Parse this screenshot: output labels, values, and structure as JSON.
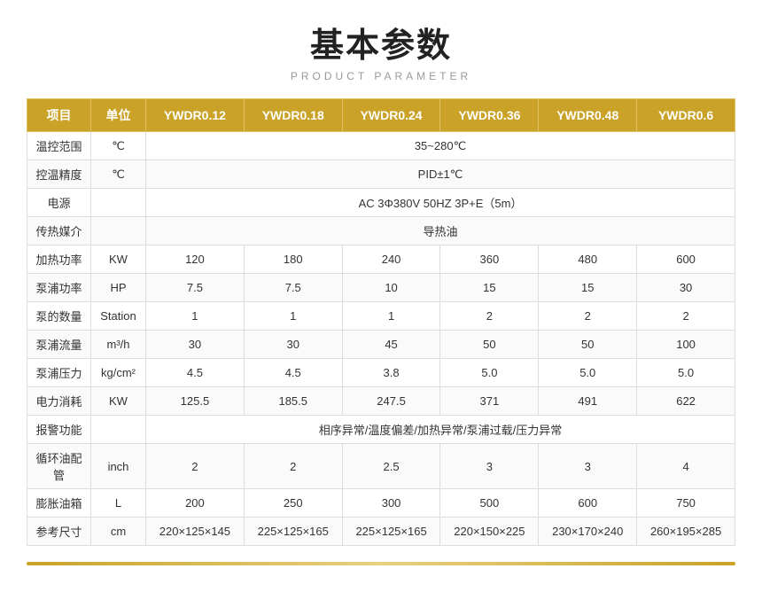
{
  "header": {
    "title": "基本参数",
    "subtitle": "PRODUCT PARAMETER"
  },
  "table": {
    "columns": [
      "项目",
      "单位",
      "YWDR0.12",
      "YWDR0.18",
      "YWDR0.24",
      "YWDR0.36",
      "YWDR0.48",
      "YWDR0.6"
    ],
    "rows": [
      {
        "label": "温控范围",
        "unit": "℃",
        "span": true,
        "spanText": "35~280℃"
      },
      {
        "label": "控温精度",
        "unit": "℃",
        "span": true,
        "spanText": "PID±1℃"
      },
      {
        "label": "电源",
        "unit": "",
        "span": true,
        "spanText": "AC 3Φ380V 50HZ 3P+E（5m）"
      },
      {
        "label": "传热媒介",
        "unit": "",
        "span": true,
        "spanText": "导热油"
      },
      {
        "label": "加热功率",
        "unit": "KW",
        "span": false,
        "values": [
          "120",
          "180",
          "240",
          "360",
          "480",
          "600"
        ]
      },
      {
        "label": "泵浦功率",
        "unit": "HP",
        "span": false,
        "values": [
          "7.5",
          "7.5",
          "10",
          "15",
          "15",
          "30"
        ]
      },
      {
        "label": "泵的数量",
        "unit": "Station",
        "span": false,
        "values": [
          "1",
          "1",
          "1",
          "2",
          "2",
          "2"
        ]
      },
      {
        "label": "泵浦流量",
        "unit": "m³/h",
        "span": false,
        "values": [
          "30",
          "30",
          "45",
          "50",
          "50",
          "100"
        ]
      },
      {
        "label": "泵浦压力",
        "unit": "kg/cm²",
        "span": false,
        "values": [
          "4.5",
          "4.5",
          "3.8",
          "5.0",
          "5.0",
          "5.0"
        ]
      },
      {
        "label": "电力消耗",
        "unit": "KW",
        "span": false,
        "values": [
          "125.5",
          "185.5",
          "247.5",
          "371",
          "491",
          "622"
        ]
      },
      {
        "label": "报警功能",
        "unit": "",
        "span": true,
        "spanText": "相序异常/温度偏差/加热异常/泵浦过载/压力异常"
      },
      {
        "label": "循环油配管",
        "unit": "inch",
        "span": false,
        "values": [
          "2",
          "2",
          "2.5",
          "3",
          "3",
          "4"
        ]
      },
      {
        "label": "膨胀油箱",
        "unit": "L",
        "span": false,
        "values": [
          "200",
          "250",
          "300",
          "500",
          "600",
          "750"
        ]
      },
      {
        "label": "参考尺寸",
        "unit": "cm",
        "span": false,
        "values": [
          "220×125×145",
          "225×125×165",
          "225×125×165",
          "220×150×225",
          "230×170×240",
          "260×195×285"
        ]
      }
    ]
  }
}
